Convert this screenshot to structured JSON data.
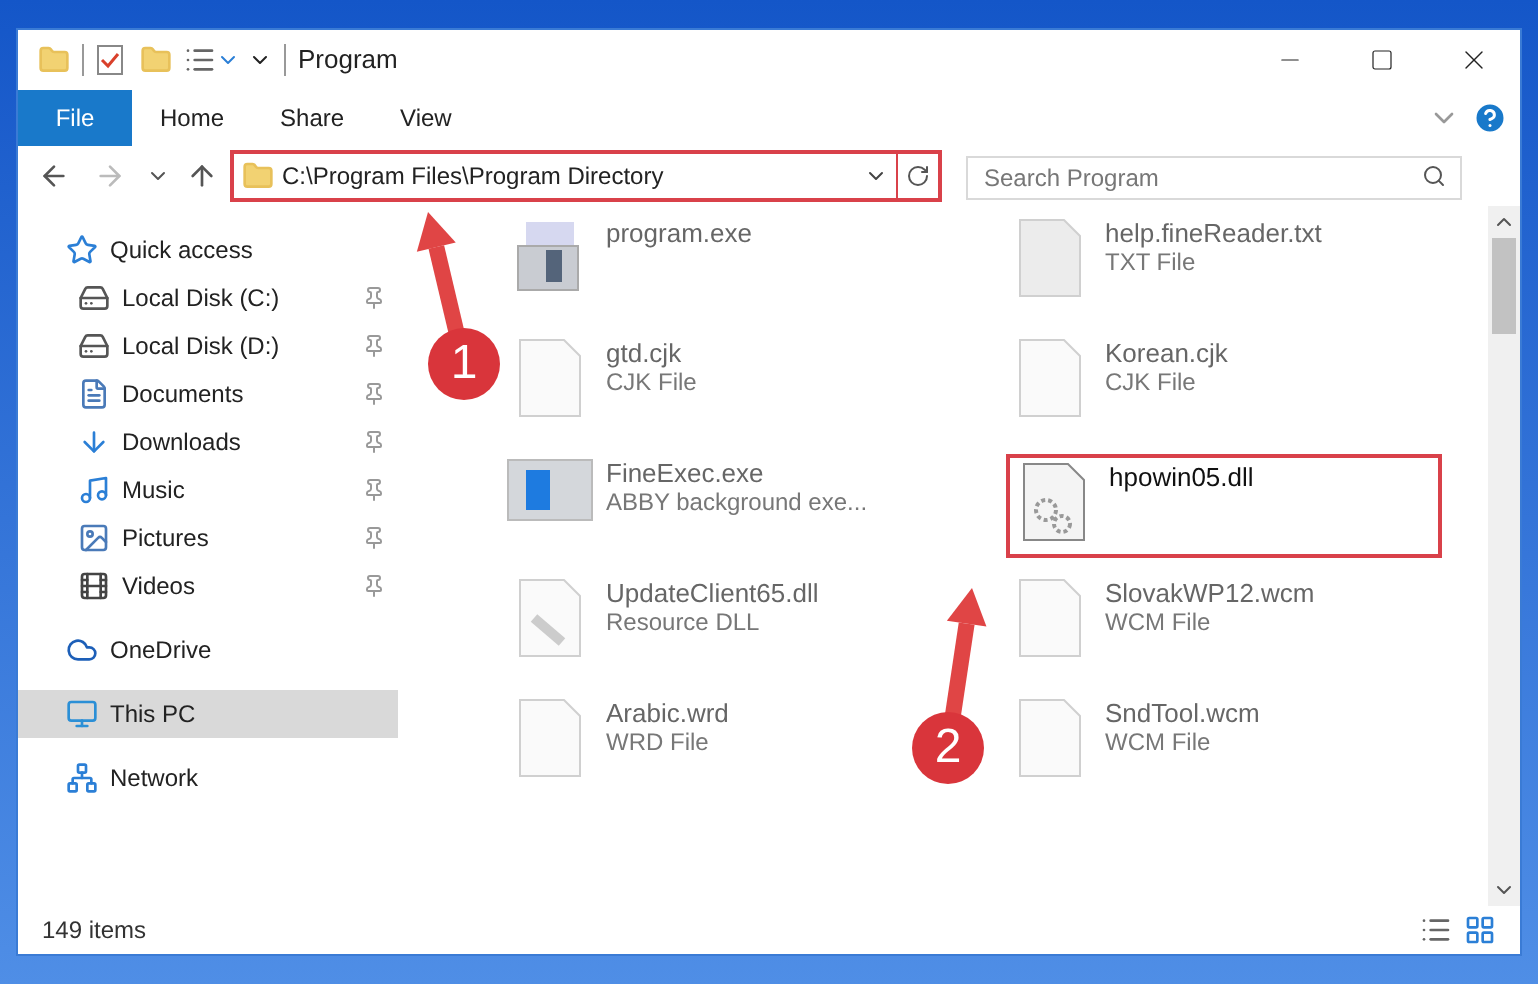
{
  "window": {
    "title": "Program"
  },
  "ribbon_tabs": [
    {
      "label": "File",
      "kind": "menu"
    },
    {
      "label": "Home",
      "kind": "tab"
    },
    {
      "label": "Share",
      "kind": "tab"
    },
    {
      "label": "View",
      "kind": "tab"
    }
  ],
  "address_bar": {
    "path": "C:\\Program Files\\Program Directory"
  },
  "search": {
    "placeholder": "Search Program"
  },
  "sidebar": {
    "items": [
      {
        "label": "Quick access",
        "kind": "star",
        "selected": false,
        "pinned": false,
        "children": [
          {
            "label": "Local Disk (C:)",
            "kind": "disk",
            "selected": false,
            "pinned": true
          },
          {
            "label": "Local Disk (D:)",
            "kind": "disk",
            "selected": false,
            "pinned": true
          },
          {
            "label": "Documents",
            "kind": "documents",
            "selected": false,
            "pinned": true
          },
          {
            "label": "Downloads",
            "kind": "downloads",
            "selected": false,
            "pinned": true
          },
          {
            "label": "Music",
            "kind": "music",
            "selected": false,
            "pinned": true
          },
          {
            "label": "Pictures",
            "kind": "pictures",
            "selected": false,
            "pinned": true
          },
          {
            "label": "Videos",
            "kind": "videos",
            "selected": false,
            "pinned": true
          }
        ]
      },
      {
        "label": "OneDrive",
        "kind": "cloud",
        "selected": false,
        "pinned": false
      },
      {
        "label": "This PC",
        "kind": "pc",
        "selected": true,
        "pinned": false
      },
      {
        "label": "Network",
        "kind": "network",
        "selected": false,
        "pinned": false
      }
    ]
  },
  "files": [
    {
      "name": "program.exe",
      "kind": "installer",
      "highlighted": false
    },
    {
      "name": "help.fineReader.txt",
      "type": "TXT File",
      "kind": "grey",
      "highlighted": false
    },
    {
      "name": "gtd.cjk",
      "type": "CJK File",
      "kind": "blank",
      "highlighted": false
    },
    {
      "name": "Korean.cjk",
      "type": "CJK File",
      "kind": "blank",
      "highlighted": false
    },
    {
      "name": "FineExec.exe",
      "type": "ABBY background exe...",
      "kind": "window",
      "highlighted": false
    },
    {
      "name": "hpowin05.dll",
      "kind": "gears",
      "highlighted": true
    },
    {
      "name": "UpdateClient65.dll",
      "type": "Resource DLL",
      "kind": "wrench",
      "highlighted": false
    },
    {
      "name": "SlovakWP12.wcm",
      "type": "WCM File",
      "kind": "blank",
      "highlighted": false
    },
    {
      "name": "Arabic.wrd",
      "type": "WRD File",
      "kind": "blank",
      "highlighted": false
    },
    {
      "name": "SndTool.wcm",
      "type": "WCM File",
      "kind": "blank",
      "highlighted": false
    }
  ],
  "status_bar": {
    "count": "149 items"
  },
  "annotations": [
    {
      "number": "1"
    },
    {
      "number": "2"
    }
  ]
}
